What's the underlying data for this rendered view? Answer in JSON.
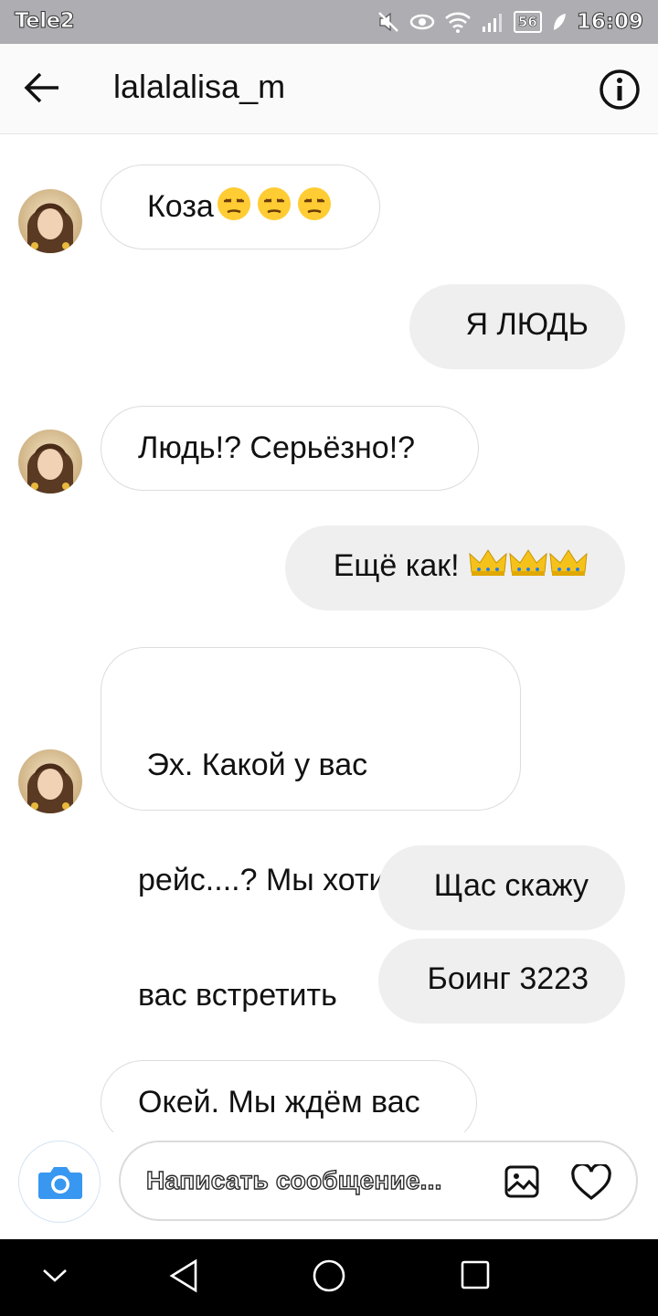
{
  "status_bar": {
    "carrier": "Tele2",
    "battery": "56",
    "time": "16:09"
  },
  "header": {
    "title": "lalalalisa_m",
    "icons": [
      "back-arrow-icon",
      "info-icon"
    ]
  },
  "messages": [
    {
      "direction": "incoming",
      "text": "Коза",
      "emoji": [
        "unamused-face",
        "unamused-face",
        "unamused-face"
      ]
    },
    {
      "direction": "outgoing",
      "text": "Я ЛЮДЬ"
    },
    {
      "direction": "incoming",
      "text": "Людь!? Серьёзно!?"
    },
    {
      "direction": "outgoing",
      "text": "Ещё как! ",
      "emoji": [
        "crown",
        "crown",
        "crown"
      ]
    },
    {
      "direction": "incoming",
      "lines": [
        " Эх. Какой у вас",
        "рейс....? Мы хотим",
        "вас встретить"
      ]
    },
    {
      "direction": "outgoing",
      "text": "Щас скажу"
    },
    {
      "direction": "outgoing",
      "text": "Боинг 3223"
    },
    {
      "direction": "incoming",
      "text": "Окей. Мы ждём вас"
    }
  ],
  "composer": {
    "placeholder": "Написать сообщение...",
    "icons": [
      "camera-icon",
      "gallery-icon",
      "heart-icon"
    ],
    "accent": "#3897f0"
  },
  "nav_bar": {
    "icons": [
      "chevron-down-icon",
      "back-triangle-icon",
      "home-circle-icon",
      "recents-square-icon"
    ]
  }
}
